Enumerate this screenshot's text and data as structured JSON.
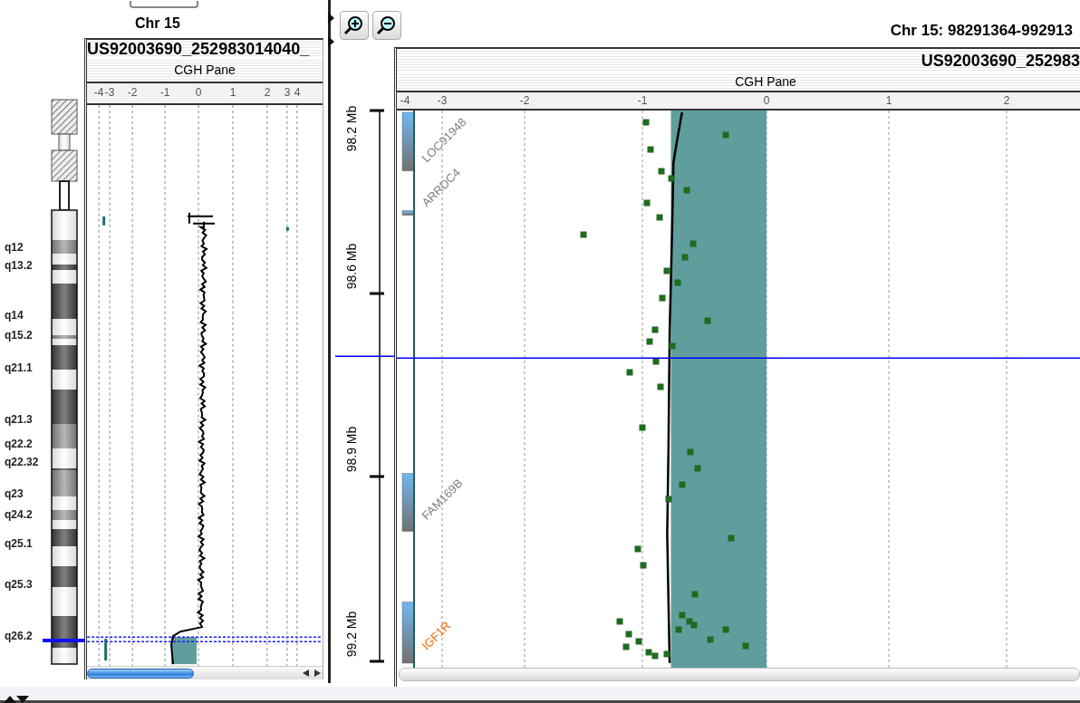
{
  "overview": {
    "title": "Chr 15",
    "pane_header": "US92003690_252983014040_",
    "pane_title": "CGH Pane",
    "axis_ticks": [
      "-4",
      "-3",
      "-2",
      "-1",
      "0",
      "1",
      "2",
      "3",
      "4"
    ],
    "band_labels": [
      "q12",
      "q13.2",
      "q14",
      "q15.2",
      "q21.1",
      "q21.3",
      "q22.2",
      "q22.32",
      "q23",
      "q24.2",
      "q25.1",
      "q25.3",
      "q26.2"
    ]
  },
  "detail": {
    "title": "Chr 15: 98291364-992913",
    "pane_header": "US92003690_252983",
    "pane_title": "CGH Pane",
    "axis_ticks": [
      "-4",
      "-3",
      "-2",
      "-1",
      "0",
      "1",
      "2"
    ],
    "position_labels": [
      "98.2 Mb",
      "98.6 Mb",
      "98.9 Mb",
      "99.2 Mb"
    ],
    "genes": [
      {
        "label": "LOC91948",
        "color": "#808080"
      },
      {
        "label": "ARRDC4",
        "color": "#808080"
      },
      {
        "label": "FAM169B",
        "color": "#808080"
      },
      {
        "label": "IGF1R",
        "color": "#ff6a00"
      }
    ]
  }
}
